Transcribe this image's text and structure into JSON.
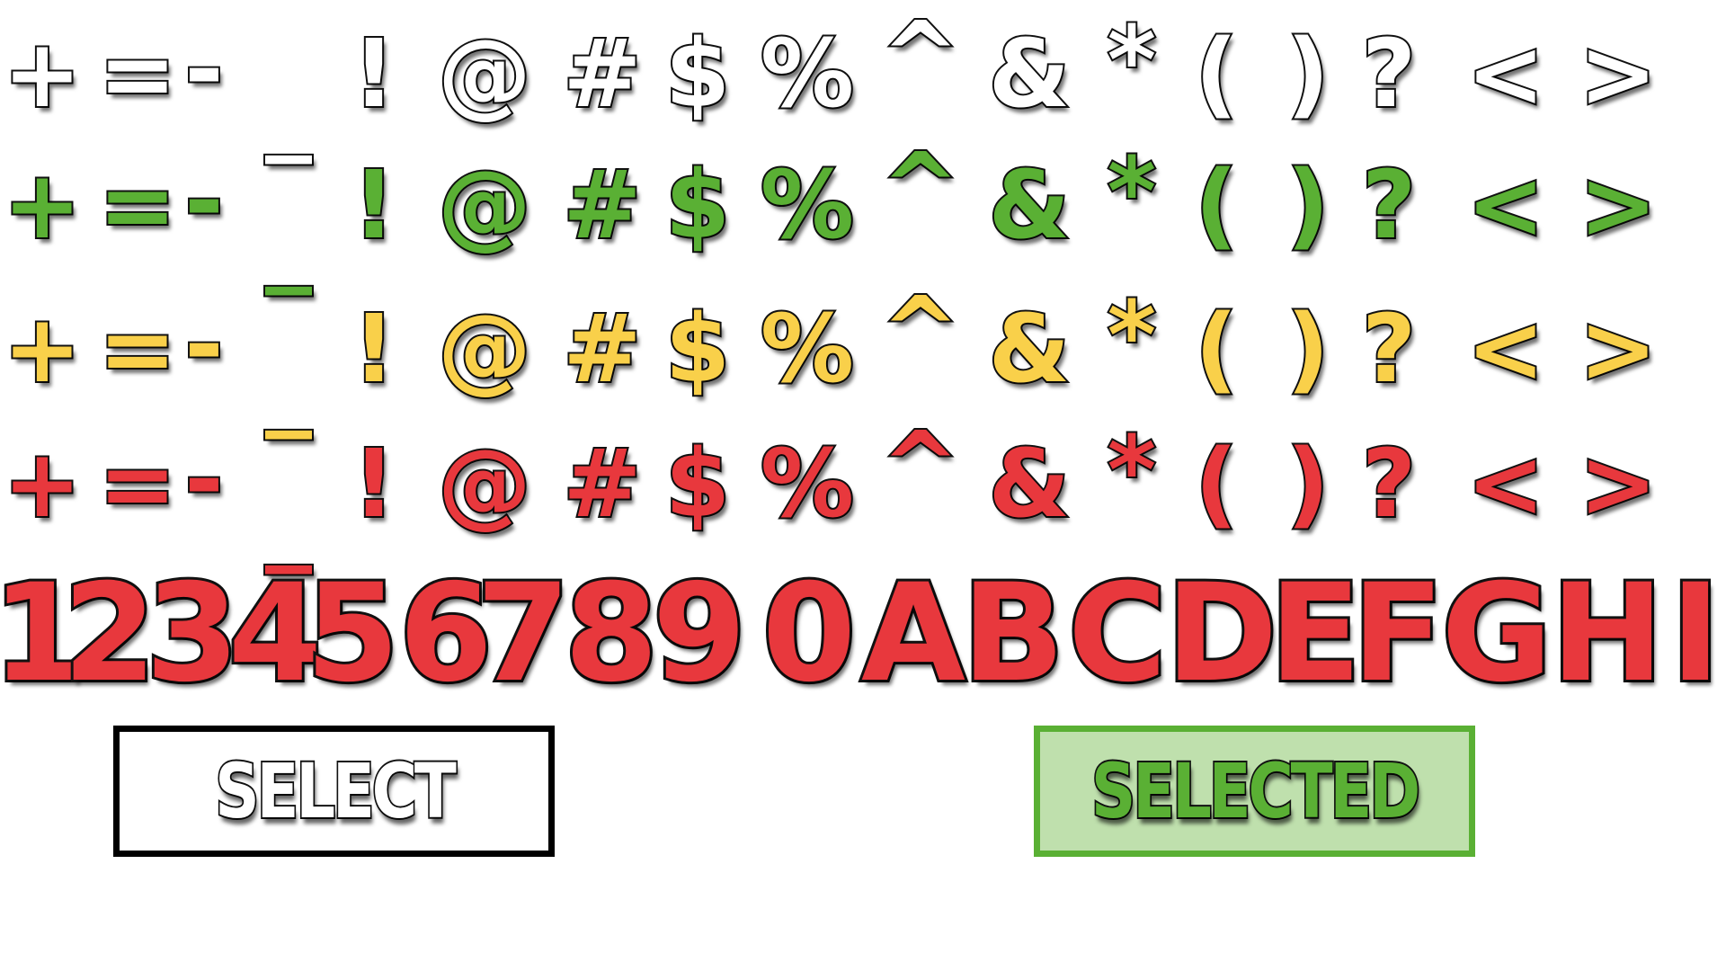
{
  "symbols": [
    "+",
    "=",
    "-",
    "_",
    "!",
    "@",
    "#",
    "$",
    "%",
    "^",
    "&",
    "*",
    "(",
    ")",
    "?",
    "<",
    ">"
  ],
  "symbol_row_colors": [
    "#ffffff",
    "#5ab034",
    "#f9d04a",
    "#e8383d"
  ],
  "characters": [
    "1",
    "2",
    "3",
    "4",
    "5",
    "6",
    "7",
    "8",
    "9",
    "0",
    "A",
    "B",
    "C",
    "D",
    "E",
    "F",
    "G",
    "H",
    "I"
  ],
  "characters_color": "#e8383d",
  "buttons": {
    "select_label": "SELECT",
    "selected_label": "SELECTED"
  },
  "colors": {
    "outline": "#111111",
    "selected_border": "#5ab034",
    "selected_fill": "#bfe0ad"
  }
}
